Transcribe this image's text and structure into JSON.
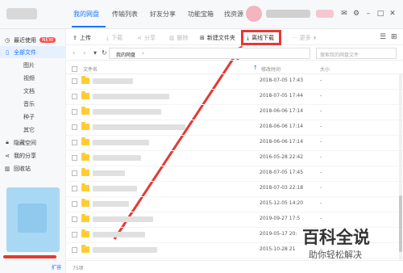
{
  "window": {
    "tabs": [
      {
        "label": "我的网盘"
      },
      {
        "label": "传输列表"
      },
      {
        "label": "好友分享"
      },
      {
        "label": "功能宝箱"
      },
      {
        "label": "找资源"
      }
    ],
    "controls": [
      "mail-icon",
      "gear-icon",
      "minimize-icon",
      "maximize-icon",
      "close-icon"
    ]
  },
  "sidebar": {
    "recent": "最近使用",
    "new_badge": "NEW",
    "all_files": "全部文件",
    "categories": [
      "图片",
      "视频",
      "文档",
      "音乐",
      "种子",
      "其它"
    ],
    "hidden_space": "隐藏空间",
    "my_share": "我的分享",
    "recycle": "回收站",
    "expand": "扩容"
  },
  "toolbar": {
    "upload": "上传",
    "download": "下载",
    "share": "分享",
    "delete": "删除",
    "new_folder": "新建文件夹",
    "offline_download": "离线下载",
    "more": "更多"
  },
  "navbar": {
    "path": "我的网盘",
    "search_placeholder": "搜索我的网盘文件"
  },
  "table": {
    "col_name": "文件名",
    "col_modified": "修改时间",
    "col_size": "大小",
    "rows": [
      {
        "modified": "2018-07-05 17:43",
        "size": "-"
      },
      {
        "modified": "2018-07-05 17:44",
        "size": "-"
      },
      {
        "modified": "2018-06-06 17:14",
        "size": "-"
      },
      {
        "modified": "2018-06-06 17:14",
        "size": "-"
      },
      {
        "modified": "2018-06-06 17:14",
        "size": "-"
      },
      {
        "modified": "2016-05-28 22:42",
        "size": "-"
      },
      {
        "modified": "2018-07-05 17:45",
        "size": "-"
      },
      {
        "modified": "2018-07-03 22:18",
        "size": "-"
      },
      {
        "modified": "2015-12-05 14:20",
        "size": "-"
      },
      {
        "modified": "2019-09-27 17:5",
        "size": "-"
      },
      {
        "modified": "2019-05-17 20:",
        "size": "-"
      },
      {
        "modified": "2015-10-28 21",
        "size": "-"
      }
    ]
  },
  "status": {
    "count": "75项"
  },
  "watermark": {
    "main": "百科全说",
    "sub": "助你轻松解决"
  },
  "colors": {
    "accent": "#1677ff",
    "highlight": "#e53935",
    "folder": "#ffcc33"
  }
}
